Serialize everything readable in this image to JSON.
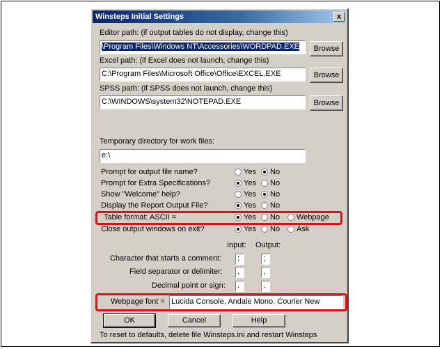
{
  "window": {
    "title": "Winsteps Initial Settings",
    "close_label": "x"
  },
  "editor": {
    "label": "Editor path: (if output tables do not display, change this)",
    "value": "\\Program Files\\Windows NT\\Accessories\\WORDPAD.EXE",
    "browse": "Browse"
  },
  "excel": {
    "label": "Excel path: (if Excel does not launch, change this)",
    "value": "C:\\Program Files\\Microsoft Office\\Office\\EXCEL.EXE",
    "browse": "Browse"
  },
  "spss": {
    "label": "SPSS path: (if SPSS does not launch, change this)",
    "value": "C:\\WINDOWS\\system32\\NOTEPAD.EXE",
    "browse": "Browse"
  },
  "temp": {
    "label": "Temporary directory for work files:",
    "value": "e:\\"
  },
  "options": [
    {
      "label": "Prompt for output file name?",
      "choices": [
        "Yes",
        "No"
      ],
      "selected": "No"
    },
    {
      "label": "Prompt for Extra Specifications?",
      "choices": [
        "Yes",
        "No"
      ],
      "selected": "Yes"
    },
    {
      "label": "Show \"Welcome\" help?",
      "choices": [
        "Yes",
        "No"
      ],
      "selected": "No"
    },
    {
      "label": "Display the Report Output File?",
      "choices": [
        "Yes",
        "No"
      ],
      "selected": "Yes"
    },
    {
      "label": "Table format: ASCII =",
      "choices": [
        "Yes",
        "No",
        "Webpage"
      ],
      "selected": "Yes"
    },
    {
      "label": "Close output windows on exit?",
      "choices": [
        "Yes",
        "No",
        "Ask"
      ],
      "selected": "Yes"
    }
  ],
  "chars": {
    "input_header": "Input:",
    "output_header": "Output:",
    "rows": [
      {
        "label": "Character that starts a comment:",
        "input": ";",
        "output": ";"
      },
      {
        "label": "Field separator or delimiter:",
        "input": ",",
        "output": ","
      },
      {
        "label": "Decimal point or sign:",
        "input": ".",
        "output": "."
      }
    ]
  },
  "webpage_font": {
    "label": "Webpage font =",
    "value": "Lucida Console, Andale Mono, Courier New"
  },
  "buttons": {
    "ok": "OK",
    "cancel": "Cancel",
    "help": "Help"
  },
  "footer": "To reset to defaults, delete file Winsteps.ini and restart Winsteps",
  "colors": {
    "highlight": "#e01010",
    "dialog_bg": "#d4d0c8",
    "title_bar": "#0a246a"
  }
}
